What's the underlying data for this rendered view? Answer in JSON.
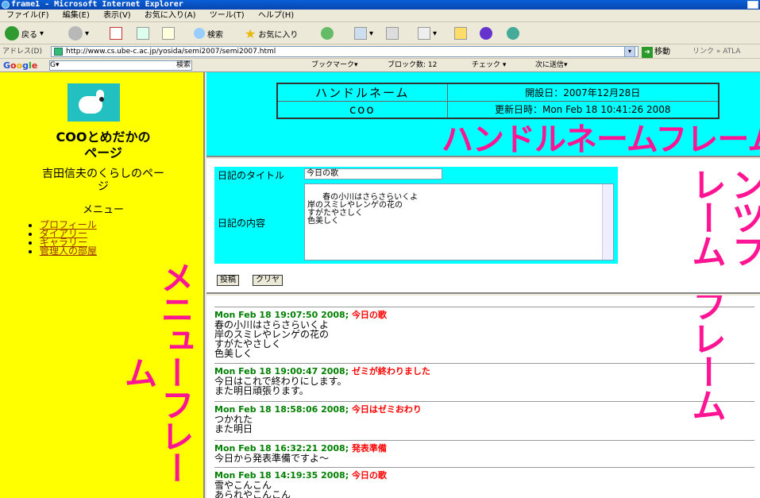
{
  "window": {
    "title": "frame1 - Microsoft Internet Explorer"
  },
  "menubar": [
    "ファイル(F)",
    "編集(E)",
    "表示(V)",
    "お気に入り(A)",
    "ツール(T)",
    "ヘルプ(H)"
  ],
  "toolbar": {
    "back_label": "戻る",
    "search_label": "検索",
    "favorites_label": "お気に入り"
  },
  "address": {
    "label": "アドレス(D)",
    "url": "http://www.cs.ube-c.ac.jp/yosida/semi2007/semi2007.html",
    "go_label": "移動",
    "links_label": "リンク »  ATLA"
  },
  "googlebar": {
    "logo": "Google",
    "input": "G▾",
    "search": "検索",
    "bookmarks": "ブックマーク▾",
    "blocked": "ブロック数: 12",
    "check": "チェック ▾",
    "send": "次に送信▾"
  },
  "menu_frame": {
    "site_title_1": "COOとめだかの",
    "site_title_2": "ページ",
    "owner_1": "吉田信夫のくらしのペー",
    "owner_2": "ジ",
    "menu_heading": "メニュー",
    "items": [
      "プロフィール",
      "ダイアリー",
      "ギャラリー",
      "管理人の部屋"
    ],
    "annotation": "メニューフレーム"
  },
  "handle_frame": {
    "handle_label": "ハンドルネーム",
    "handle_value": "coo",
    "opened": "開設日：2007年12月28日",
    "updated": "更新日時：Mon Feb 18 10:41:26 2008",
    "annotation": "ハンドルネームフレーム"
  },
  "content_frame": {
    "title_label": "日記のタイトル",
    "title_value": "今日の歌",
    "body_label": "日記の内容",
    "body_value": "春の小川はさらさらいくよ\n岸のスミレやレンゲの花の\nすがたやさしく\n色美しく",
    "submit_label": "投稿",
    "clear_label": "クリヤ",
    "annotation": "コンテンツフレーム"
  },
  "diary": {
    "entries": [
      {
        "date": "Mon Feb 18 19:07:50 2008;",
        "title": "今日の歌",
        "lines": [
          "春の小川はさらさらいくよ",
          "岸のスミレやレンゲの花の",
          "すがたやさしく",
          "色美しく"
        ]
      },
      {
        "date": "Mon Feb 18 19:00:47 2008;",
        "title": "ゼミが終わりました",
        "lines": [
          "今日はこれで終わりにします。",
          "また明日頑張ります。"
        ]
      },
      {
        "date": "Mon Feb 18 18:58:06 2008;",
        "title": "今日はゼミおわり",
        "lines": [
          "つかれた",
          "また明日"
        ]
      },
      {
        "date": "Mon Feb 18 16:32:21 2008;",
        "title": "発表準備",
        "lines": [
          "今日から発表準備ですよ〜"
        ]
      },
      {
        "date": "Mon Feb 18 14:19:35 2008;",
        "title": "今日の歌",
        "lines": [
          "雪やこんこん",
          "あられやこんこん"
        ]
      }
    ],
    "annotation": "フレーム"
  },
  "colors": {
    "menu_bg": "#ffff00",
    "handle_bg": "#00ffff",
    "annotation": "#ff1493",
    "date": "#008000",
    "entry_title": "#ff0000"
  }
}
